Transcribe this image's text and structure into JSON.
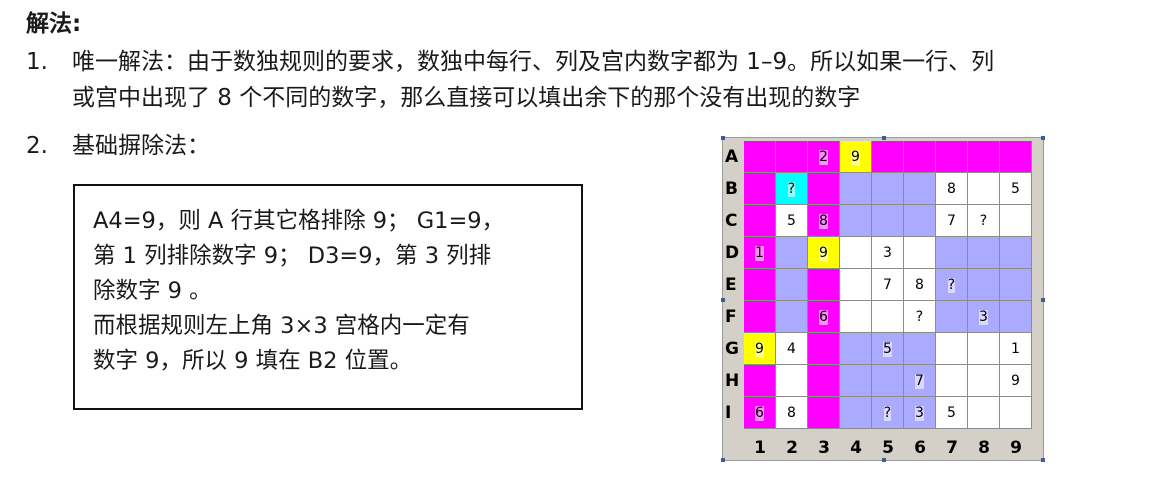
{
  "heading": "解法:",
  "items": [
    {
      "number": "1.",
      "line1": "唯一解法：由于数独规则的要求，数独中每行、列及宫内数字都为 1–9。所以如果一行、列",
      "line2": "或宫中出现了 8 个不同的数字，那么直接可以填出余下的那个没有出现的数字"
    },
    {
      "number": "2.",
      "line1": "基础摒除法："
    }
  ],
  "box_lines": [
    "A4=9，则 A 行其它格排除 9； G1=9，",
    "第 1 列排除数字 9； D3=9，第 3 列排",
    "除数字 9 。",
    "而根据规则左上角 3×3 宫格内一定有",
    "数字 9，所以 9 填在 B2 位置。"
  ],
  "sudoku": {
    "row_labels": [
      "A",
      "B",
      "C",
      "D",
      "E",
      "F",
      "G",
      "H",
      "I"
    ],
    "col_labels": [
      "1",
      "2",
      "3",
      "4",
      "5",
      "6",
      "7",
      "8",
      "9"
    ],
    "colors": {
      "m": "#ff00ff",
      "y": "#ffff00",
      "c": "#00ffff",
      "l": "#aaaaff",
      "w": "#ffffff"
    },
    "fills": [
      [
        "m",
        "m",
        "m",
        "y",
        "m",
        "m",
        "m",
        "m",
        "m"
      ],
      [
        "m",
        "c",
        "m",
        "l",
        "l",
        "l",
        "w",
        "w",
        "w"
      ],
      [
        "m",
        "w",
        "m",
        "l",
        "l",
        "l",
        "w",
        "w",
        "w"
      ],
      [
        "m",
        "l",
        "y",
        "w",
        "w",
        "w",
        "l",
        "l",
        "l"
      ],
      [
        "m",
        "l",
        "m",
        "w",
        "w",
        "w",
        "l",
        "l",
        "l"
      ],
      [
        "m",
        "l",
        "m",
        "w",
        "w",
        "w",
        "l",
        "l",
        "l"
      ],
      [
        "y",
        "w",
        "m",
        "l",
        "l",
        "l",
        "w",
        "w",
        "w"
      ],
      [
        "m",
        "w",
        "m",
        "l",
        "l",
        "l",
        "w",
        "w",
        "w"
      ],
      [
        "m",
        "w",
        "m",
        "l",
        "l",
        "l",
        "w",
        "w",
        "w"
      ]
    ],
    "values": [
      [
        "",
        "",
        "2",
        "9",
        "",
        "",
        "",
        "",
        ""
      ],
      [
        "",
        "?",
        "",
        "",
        "",
        "",
        "8",
        "",
        "5"
      ],
      [
        "",
        "5",
        "8",
        "",
        "",
        "",
        "7",
        "?",
        ""
      ],
      [
        "1",
        "",
        "9",
        "",
        "3",
        "",
        "",
        "",
        ""
      ],
      [
        "",
        "",
        "",
        "",
        "7",
        "8",
        "?",
        "",
        ""
      ],
      [
        "",
        "",
        "6",
        "",
        "",
        "?",
        "",
        "3",
        ""
      ],
      [
        "9",
        "4",
        "",
        "",
        "5",
        "",
        "",
        "",
        "1"
      ],
      [
        "",
        "",
        "",
        "",
        "",
        "7",
        "",
        "",
        "9"
      ],
      [
        "6",
        "8",
        "",
        "",
        "?",
        "3",
        "5",
        "",
        ""
      ]
    ]
  }
}
